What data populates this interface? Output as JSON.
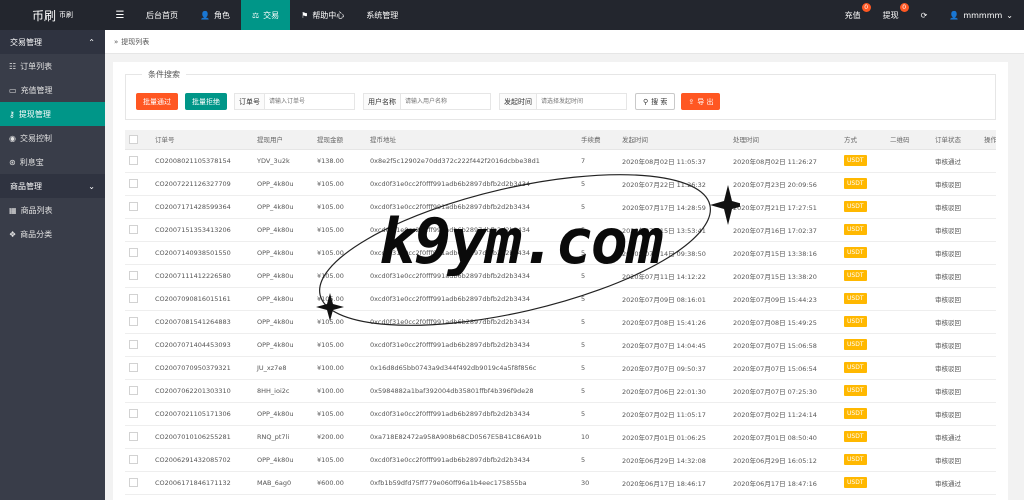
{
  "header": {
    "logo_main": "币刷",
    "logo_sub": "币刷",
    "nav": [
      {
        "label": "后台首页",
        "icon": "home-icon"
      },
      {
        "label": "角色",
        "icon": "user-icon"
      },
      {
        "label": "交易",
        "icon": "trade-icon",
        "active": true
      },
      {
        "label": "帮助中心",
        "icon": "flag-icon"
      },
      {
        "label": "系统管理",
        "icon": ""
      }
    ],
    "recharge_label": "充值",
    "recharge_badge": "0",
    "withdraw_label": "提现",
    "withdraw_badge": "0",
    "username": "mmmmm"
  },
  "sidebar": {
    "groups": [
      {
        "label": "交易管理",
        "items": [
          {
            "label": "订单列表",
            "icon": "list-icon"
          },
          {
            "label": "充值管理",
            "icon": "wallet-icon"
          },
          {
            "label": "提现管理",
            "icon": "key-icon",
            "active": true
          },
          {
            "label": "交易控制",
            "icon": "control-icon"
          },
          {
            "label": "利息宝",
            "icon": "coin-icon"
          }
        ]
      },
      {
        "label": "商品管理",
        "items": [
          {
            "label": "商品列表",
            "icon": "grid-icon"
          },
          {
            "label": "商品分类",
            "icon": "category-icon"
          }
        ]
      }
    ]
  },
  "breadcrumb": {
    "prefix": "»",
    "current": "提现列表"
  },
  "search": {
    "legend": "条件搜索",
    "batch_approve": "批量通过",
    "batch_reject": "批量拒绝",
    "order_label": "订单号",
    "order_placeholder": "请输入订单号",
    "user_label": "用户名称",
    "user_placeholder": "请输入用户名称",
    "time_label": "发起时间",
    "time_placeholder": "请选择发起时间",
    "search_button": "搜 索",
    "export_button": "导 出"
  },
  "table": {
    "columns": [
      "",
      "订单号",
      "提现用户",
      "提现金额",
      "提币地址",
      "手续费",
      "发起时间",
      "处理时间",
      "方式",
      "二维码",
      "订单状态",
      "操作"
    ],
    "rows": [
      [
        "CO2008021105378154",
        "YDV_3u2k",
        "¥138.00",
        "0x8e2f5c12902e70dd372c222f442f2016dcbbe38d1",
        "7",
        "2020年08月02日 11:05:37",
        "2020年08月02日 11:26:27",
        "USDT",
        "",
        "审核通过"
      ],
      [
        "CO2007221126327709",
        "OPP_4k80u",
        "¥105.00",
        "0xcd0f31e0cc2f0fff991adb6b2897dbfb2d2b3434",
        "5",
        "2020年07月22日 11:26:32",
        "2020年07月23日 20:09:56",
        "USDT",
        "",
        "审核驳回"
      ],
      [
        "CO2007171428599364",
        "OPP_4k80u",
        "¥105.00",
        "0xcd0f31e0cc2f0fff991adb6b2897dbfb2d2b3434",
        "5",
        "2020年07月17日 14:28:59",
        "2020年07月21日 17:27:51",
        "USDT",
        "",
        "审核驳回"
      ],
      [
        "CO2007151353413206",
        "OPP_4k80u",
        "¥105.00",
        "0xcd0f31e0cc2f0fff991adb6b2897dbfb2d2b3434",
        "5",
        "2020年07月15日 13:53:41",
        "2020年07月16日 17:02:37",
        "USDT",
        "",
        "审核驳回"
      ],
      [
        "CO2007140938501550",
        "OPP_4k80u",
        "¥105.00",
        "0xcd0f31e0cc2f0fff991adb6b2897dbfb2d2b3434",
        "5",
        "2020年07月14日 09:38:50",
        "2020年07月15日 13:38:16",
        "USDT",
        "",
        "审核驳回"
      ],
      [
        "CO2007111412226580",
        "OPP_4k80u",
        "¥105.00",
        "0xcd0f31e0cc2f0fff991adb6b2897dbfb2d2b3434",
        "5",
        "2020年07月11日 14:12:22",
        "2020年07月15日 13:38:20",
        "USDT",
        "",
        "审核驳回"
      ],
      [
        "CO2007090816015161",
        "OPP_4k80u",
        "¥105.00",
        "0xcd0f31e0cc2f0fff991adb6b2897dbfb2d2b3434",
        "5",
        "2020年07月09日 08:16:01",
        "2020年07月09日 15:44:23",
        "USDT",
        "",
        "审核驳回"
      ],
      [
        "CO2007081541264883",
        "OPP_4k80u",
        "¥105.00",
        "0xcd0f31e0cc2f0fff991adb6b2897dbfb2d2b3434",
        "5",
        "2020年07月08日 15:41:26",
        "2020年07月08日 15:49:25",
        "USDT",
        "",
        "审核驳回"
      ],
      [
        "CO2007071404453093",
        "OPP_4k80u",
        "¥105.00",
        "0xcd0f31e0cc2f0fff991adb6b2897dbfb2d2b3434",
        "5",
        "2020年07月07日 14:04:45",
        "2020年07月07日 15:06:58",
        "USDT",
        "",
        "审核驳回"
      ],
      [
        "CO2007070950379321",
        "JU_xz7e8",
        "¥100.00",
        "0x16d8d65bb0743a9d344f492db9019c4a5f8f856c",
        "5",
        "2020年07月07日 09:50:37",
        "2020年07月07日 15:06:54",
        "USDT",
        "",
        "审核驳回"
      ],
      [
        "CO2007062201303310",
        "8HH_ioi2c",
        "¥100.00",
        "0x5984882a1baf392004db35801ffbf4b396f9de28",
        "5",
        "2020年07月06日 22:01:30",
        "2020年07月07日 07:25:30",
        "USDT",
        "",
        "审核驳回"
      ],
      [
        "CO2007021105171306",
        "OPP_4k80u",
        "¥105.00",
        "0xcd0f31e0cc2f0fff991adb6b2897dbfb2d2b3434",
        "5",
        "2020年07月02日 11:05:17",
        "2020年07月02日 11:24:14",
        "USDT",
        "",
        "审核驳回"
      ],
      [
        "CO2007010106255281",
        "RNQ_pt7li",
        "¥200.00",
        "0xa718E82472a958A908b68CD0567E5B41C86A91b",
        "10",
        "2020年07月01日 01:06:25",
        "2020年07月01日 08:50:40",
        "USDT",
        "",
        "审核通过"
      ],
      [
        "CO2006291432085702",
        "OPP_4k80u",
        "¥105.00",
        "0xcd0f31e0cc2f0fff991adb6b2897dbfb2d2b3434",
        "5",
        "2020年06月29日 14:32:08",
        "2020年06月29日 16:05:12",
        "USDT",
        "",
        "审核驳回"
      ],
      [
        "CO2006171846171132",
        "MAB_6ag0",
        "¥600.00",
        "0xfb1b59dfd75ff779e060ff96a1b4eec175855ba",
        "30",
        "2020年06月17日 18:46:17",
        "2020年06月17日 18:47:16",
        "USDT",
        "",
        "审核通过"
      ]
    ]
  },
  "watermark": {
    "text": "k9ym.com"
  }
}
